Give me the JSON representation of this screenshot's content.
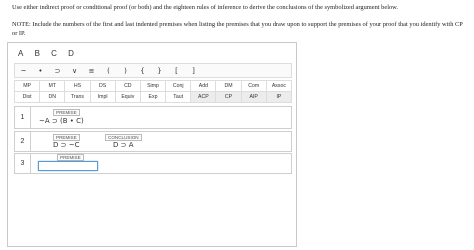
{
  "instructions": {
    "line1": "Use either indirect proof or conditional proof (or both) and the eighteen rules of inference to derive the conclusions of the symbolized argument below.",
    "line2": "NOTE: Include the numbers of the first and last indented premises when listing the premises that you draw upon to support the premises of your proof that you identify with CP or IP."
  },
  "variables": [
    "A",
    "B",
    "C",
    "D"
  ],
  "symbols": [
    "~",
    "•",
    "⊃",
    "∨",
    "≡",
    "(",
    ")",
    "{",
    "}",
    "[",
    "]"
  ],
  "rules": {
    "row1": [
      "MP",
      "MT",
      "HS",
      "DS",
      "CD",
      "Simp",
      "Conj",
      "Add",
      "DM",
      "Com",
      "Assoc"
    ],
    "row2": [
      "Dist",
      "DN",
      "Trans",
      "Impl",
      "Equiv",
      "Exp",
      "Taut",
      "ACP",
      "CP",
      "AIP",
      "IP"
    ]
  },
  "proof": {
    "line1": {
      "num": "1",
      "tag": "PREMISE",
      "formula": "~A ⊃ (B • C)"
    },
    "line2": {
      "num": "2",
      "tag": "PREMISE",
      "formula": "D ⊃ ~C",
      "conclusion_tag": "CONCLUSION",
      "conclusion": "D ⊃ A"
    },
    "line3": {
      "num": "3",
      "tag": "PREMISE",
      "value": ""
    }
  }
}
